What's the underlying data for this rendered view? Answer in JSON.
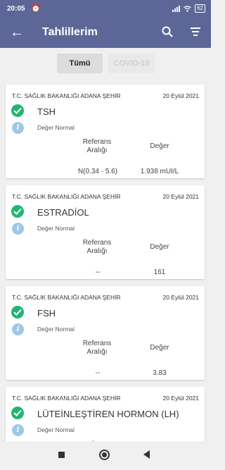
{
  "status_bar": {
    "time": "20:05",
    "battery": "62"
  },
  "header": {
    "title": "Tahlillerim"
  },
  "tabs": [
    {
      "label": "Tümü"
    },
    {
      "label": "COVID-19"
    }
  ],
  "card_labels": {
    "status": "Değer Normal",
    "reference_header": "Referans Aralığı",
    "value_header": "Değer"
  },
  "results": [
    {
      "institution": "T.C. SAĞLIK BAKANLIĞI ADANA ŞEHİR",
      "date": "20 Eylül 2021",
      "test": "TSH",
      "reference": "N(0.34 - 5.6)",
      "value": "1.938 mUI/L"
    },
    {
      "institution": "T.C. SAĞLIK BAKANLIĞI ADANA ŞEHİR",
      "date": "20 Eylül 2021",
      "test": "ESTRADİOL",
      "reference": "--",
      "value": "161"
    },
    {
      "institution": "T.C. SAĞLIK BAKANLIĞI ADANA ŞEHİR",
      "date": "20 Eylül 2021",
      "test": "FSH",
      "reference": "--",
      "value": "3.83"
    },
    {
      "institution": "T.C. SAĞLIK BAKANLIĞI ADANA ŞEHİR",
      "date": "20 Eylül 2021",
      "test": "LÜTEİNLEŞTİREN HORMON (LH)",
      "reference": "",
      "value": ""
    }
  ],
  "colors": {
    "header_bg": "#5c6797",
    "check_green": "#22b573",
    "info_blue": "#9fc7e6"
  }
}
